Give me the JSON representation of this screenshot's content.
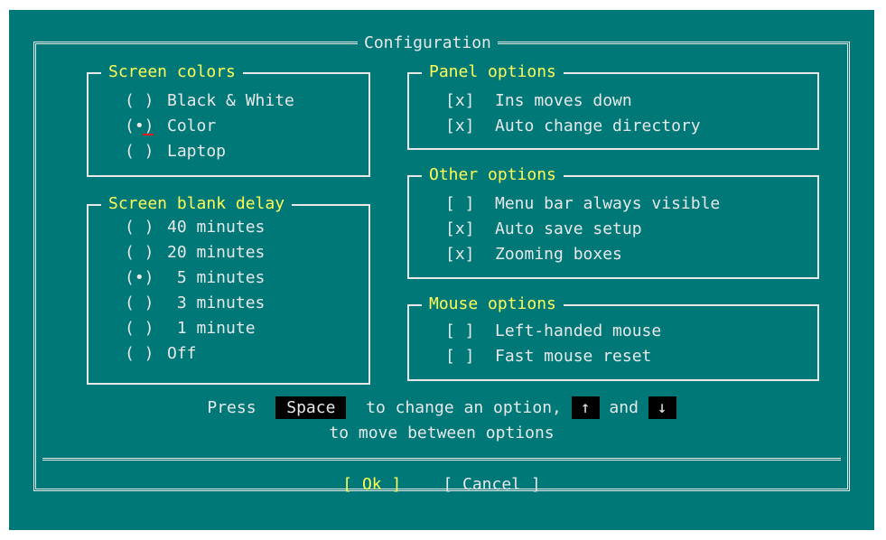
{
  "dialog": {
    "title": "Configuration"
  },
  "screen_colors": {
    "title": "Screen colors",
    "options": [
      {
        "mark": "( )",
        "label": "Black & White",
        "selected": false
      },
      {
        "mark": "(•)",
        "label": "Color",
        "selected": true
      },
      {
        "mark": "( )",
        "label": "Laptop",
        "selected": false
      }
    ]
  },
  "screen_blank": {
    "title": "Screen blank delay",
    "options": [
      {
        "mark": "( )",
        "label": "40 minutes",
        "selected": false
      },
      {
        "mark": "( )",
        "label": "20 minutes",
        "selected": false
      },
      {
        "mark": "(•)",
        "label": " 5 minutes",
        "selected": true
      },
      {
        "mark": "( )",
        "label": " 3 minutes",
        "selected": false
      },
      {
        "mark": "( )",
        "label": " 1 minute",
        "selected": false
      },
      {
        "mark": "( )",
        "label": "Off",
        "selected": false
      }
    ]
  },
  "panel_options": {
    "title": "Panel options",
    "options": [
      {
        "mark": "[x]",
        "label": "Ins moves down",
        "checked": true
      },
      {
        "mark": "[x]",
        "label": "Auto change directory",
        "checked": true
      }
    ]
  },
  "other_options": {
    "title": "Other options",
    "options": [
      {
        "mark": "[ ]",
        "label": "Menu bar always visible",
        "checked": false
      },
      {
        "mark": "[x]",
        "label": "Auto save setup",
        "checked": true
      },
      {
        "mark": "[x]",
        "label": "Zooming boxes",
        "checked": true
      }
    ]
  },
  "mouse_options": {
    "title": "Mouse options",
    "options": [
      {
        "mark": "[ ]",
        "label": "Left-handed mouse",
        "checked": false
      },
      {
        "mark": "[ ]",
        "label": "Fast mouse reset",
        "checked": false
      }
    ]
  },
  "hint": {
    "press": "Press",
    "space_key": "Space",
    "middle": "to change an option,",
    "up_key": "↑",
    "and": "and",
    "down_key": "↓",
    "line2": "to move between options"
  },
  "buttons": {
    "ok": "[ Ok ]",
    "cancel": "[ Cancel ]"
  },
  "colors": {
    "background": "#007878",
    "frame": "#e8e8e8",
    "highlight": "#ffff55",
    "key_bg": "#000000",
    "cursor": "#e02020"
  }
}
